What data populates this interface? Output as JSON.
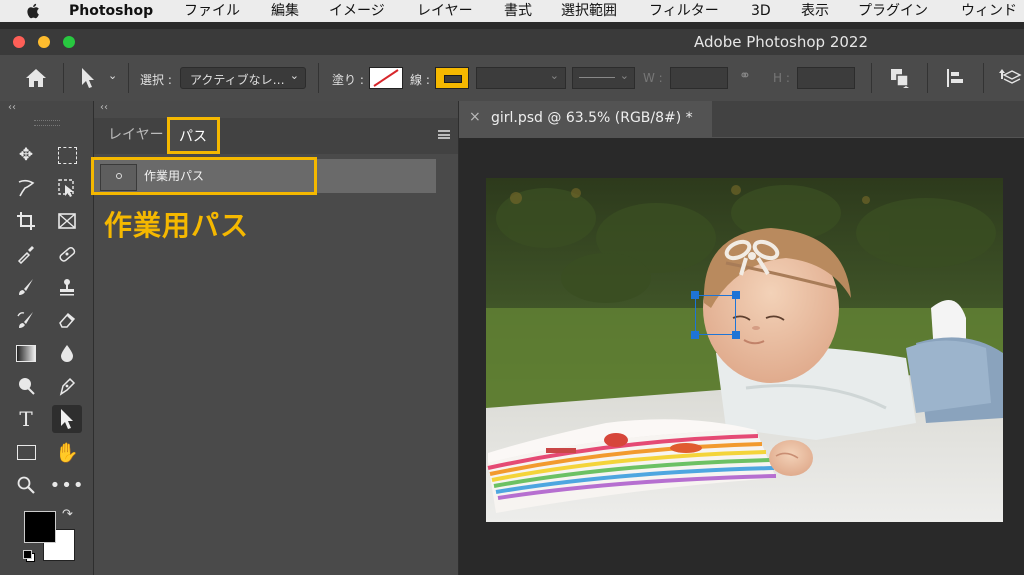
{
  "menubar": {
    "apple_icon": "apple-logo",
    "app_name": "Photoshop",
    "items": [
      "ファイル",
      "編集",
      "イメージ",
      "レイヤー",
      "書式",
      "選択範囲",
      "フィルター",
      "3D",
      "表示",
      "プラグイン",
      "ウィンド"
    ]
  },
  "window": {
    "title": "Adobe Photoshop 2022"
  },
  "options_bar": {
    "select_label": "選択 :",
    "select_value": "アクティブなレ…",
    "fill_label": "塗り :",
    "stroke_label": "線 :",
    "w_label": "W :",
    "h_label": "H :",
    "stroke_color": "#f5b800"
  },
  "paths_panel": {
    "tab_layers": "レイヤー",
    "tab_paths": "パス",
    "path_item": "作業用パス",
    "annotation": "作業用パス",
    "highlight_color": "#f5b800"
  },
  "document": {
    "tab_close": "×",
    "tab_title": "girl.psd @ 63.5% (RGB/8#) *",
    "path_color": "#1e74d6"
  }
}
